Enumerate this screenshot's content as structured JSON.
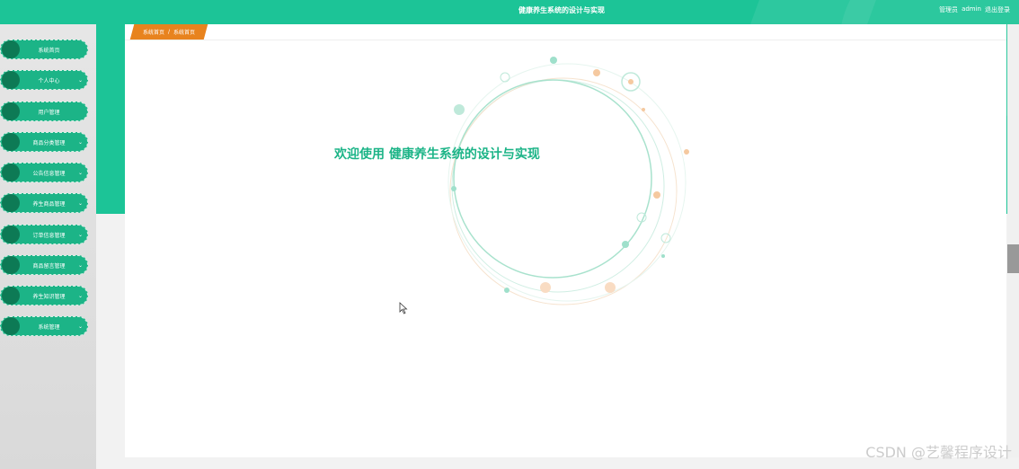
{
  "header": {
    "title": "健康养生系统的设计与实现",
    "role": "管理员",
    "user": "admin",
    "logout": "退出登录"
  },
  "sidebar": {
    "items": [
      {
        "label": "系统首页",
        "has_arrow": false
      },
      {
        "label": "个人中心",
        "has_arrow": true
      },
      {
        "label": "用户管理",
        "has_arrow": false
      },
      {
        "label": "商品分类管理",
        "has_arrow": true
      },
      {
        "label": "公告信息管理",
        "has_arrow": true
      },
      {
        "label": "养生商品管理",
        "has_arrow": true
      },
      {
        "label": "订单信息管理",
        "has_arrow": true
      },
      {
        "label": "商品留言管理",
        "has_arrow": true
      },
      {
        "label": "养生知识管理",
        "has_arrow": true
      },
      {
        "label": "系统管理",
        "has_arrow": true
      }
    ]
  },
  "breadcrumb": {
    "home": "系统首页",
    "sep": "/",
    "current": "系统首页"
  },
  "welcome": {
    "text": "欢迎使用 健康养生系统的设计与实现"
  },
  "watermark": "CSDN @艺馨程序设计",
  "colors": {
    "primary": "#1cc497",
    "menu": "#1cb487",
    "menu_dot": "#0d7a55",
    "crumb": "#e8831e",
    "welcome": "#1cb487"
  }
}
